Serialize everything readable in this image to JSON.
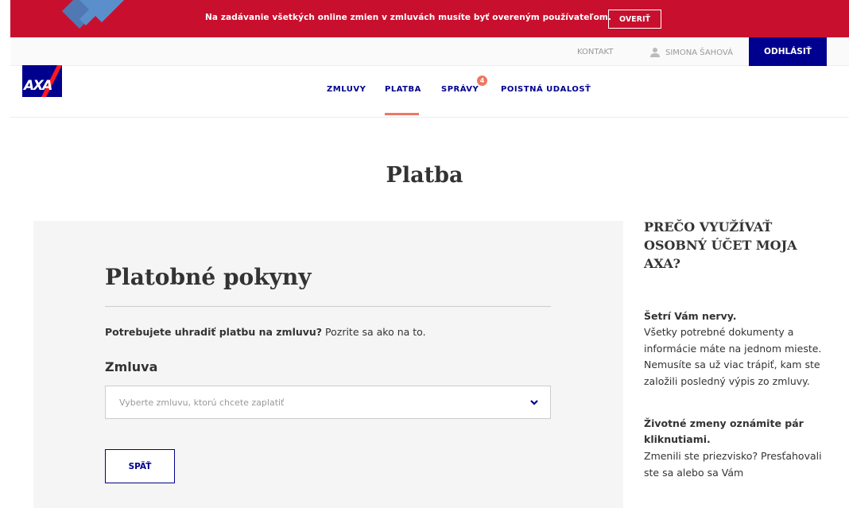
{
  "alert": {
    "message": "Na zadávanie všetkých online zmien v zmluvách musíte byť overeným používateľom.",
    "verify_label": "OVERIŤ"
  },
  "utility": {
    "contact_label": "KONTAKT",
    "user_name": "SIMONA ŠAHOVÁ",
    "logout_label": "ODHLÁSIŤ"
  },
  "logo": {
    "text": "AXA"
  },
  "nav": {
    "items": [
      {
        "label": "ZMLUVY"
      },
      {
        "label": "PLATBA"
      },
      {
        "label": "SPRÁVY"
      },
      {
        "label": "POISTNÁ UDALOSŤ"
      }
    ],
    "messages_badge": "4"
  },
  "page": {
    "title": "Platba"
  },
  "form": {
    "title": "Platobné pokyny",
    "intro_bold": "Potrebujete uhradiť platbu na zmluvu?",
    "intro_rest": " Pozrite sa ako na to.",
    "contract_label": "Zmluva",
    "contract_placeholder": "Vyberte zmluvu, ktorú chcete zaplatiť",
    "back_label": "SPÄŤ"
  },
  "sidebar": {
    "title": "PREČO VYUŽÍVAŤ OSOBNÝ ÚČET MOJA AXA?",
    "sections": [
      {
        "heading": "Šetrí Vám nervy.",
        "text": "Všetky potrebné dokumenty a informácie máte na jednom mieste. Nemusíte sa už viac trápiť, kam ste založili posledný výpis zo zmluvy."
      },
      {
        "heading": "Životné zmeny oznámite pár kliknutiami.",
        "text": "Zmenili ste priezvisko? Presťahovali ste sa alebo sa Vám"
      }
    ]
  },
  "colors": {
    "alert_red": "#c8102e",
    "axa_blue": "#00008f",
    "accent_coral": "#f07662"
  }
}
